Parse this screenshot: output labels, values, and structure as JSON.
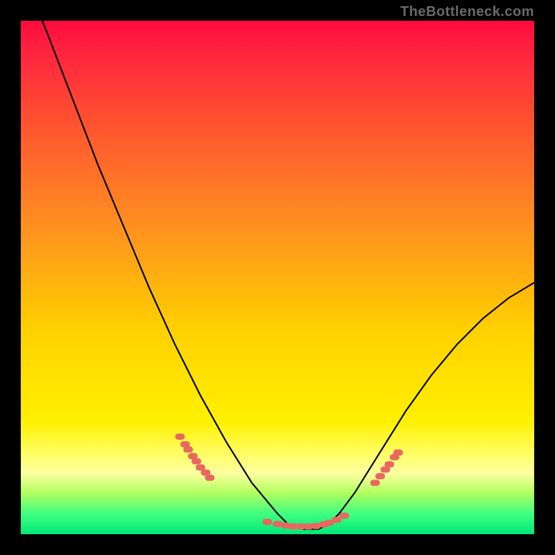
{
  "watermark": "TheBottleneck.com",
  "colors": {
    "background": "#000000",
    "gradient_top": "#ff0a3c",
    "gradient_bottom": "#00e878",
    "curve": "#000000",
    "marker": "#e86860"
  },
  "chart_data": {
    "type": "line",
    "title": "",
    "xlabel": "",
    "ylabel": "",
    "xlim": [
      0,
      100
    ],
    "ylim": [
      0,
      100
    ],
    "series": [
      {
        "name": "bottleneck-curve",
        "x": [
          0,
          5,
          10,
          15,
          20,
          25,
          30,
          35,
          40,
          45,
          50,
          52,
          55,
          58,
          60,
          62,
          65,
          70,
          75,
          80,
          85,
          90,
          95,
          100
        ],
        "y": [
          110,
          98,
          85,
          72,
          60,
          48,
          37,
          27,
          18,
          10,
          4,
          2,
          1,
          1,
          2,
          4,
          8,
          16,
          24,
          31,
          37,
          42,
          46,
          49
        ]
      }
    ],
    "markers": [
      {
        "name": "left-cluster",
        "points": [
          {
            "x": 31,
            "y": 19.0
          },
          {
            "x": 32,
            "y": 17.5
          },
          {
            "x": 32.6,
            "y": 16.5
          },
          {
            "x": 33.5,
            "y": 15.2
          },
          {
            "x": 34.2,
            "y": 14.2
          },
          {
            "x": 35,
            "y": 13.0
          },
          {
            "x": 36,
            "y": 12.0
          },
          {
            "x": 36.8,
            "y": 11.0
          }
        ]
      },
      {
        "name": "valley-cluster",
        "points": [
          {
            "x": 48,
            "y": 2.4
          },
          {
            "x": 50,
            "y": 2.0
          },
          {
            "x": 51.5,
            "y": 1.7
          },
          {
            "x": 53,
            "y": 1.5
          },
          {
            "x": 54.5,
            "y": 1.5
          },
          {
            "x": 56,
            "y": 1.5
          },
          {
            "x": 57.5,
            "y": 1.6
          },
          {
            "x": 59,
            "y": 1.9
          },
          {
            "x": 60,
            "y": 2.2
          },
          {
            "x": 61.5,
            "y": 2.8
          },
          {
            "x": 63,
            "y": 3.6
          }
        ]
      },
      {
        "name": "right-cluster",
        "points": [
          {
            "x": 69,
            "y": 10.0
          },
          {
            "x": 70,
            "y": 11.3
          },
          {
            "x": 71,
            "y": 12.6
          },
          {
            "x": 71.8,
            "y": 13.6
          },
          {
            "x": 72.8,
            "y": 15.0
          },
          {
            "x": 73.5,
            "y": 15.9
          }
        ]
      }
    ]
  }
}
